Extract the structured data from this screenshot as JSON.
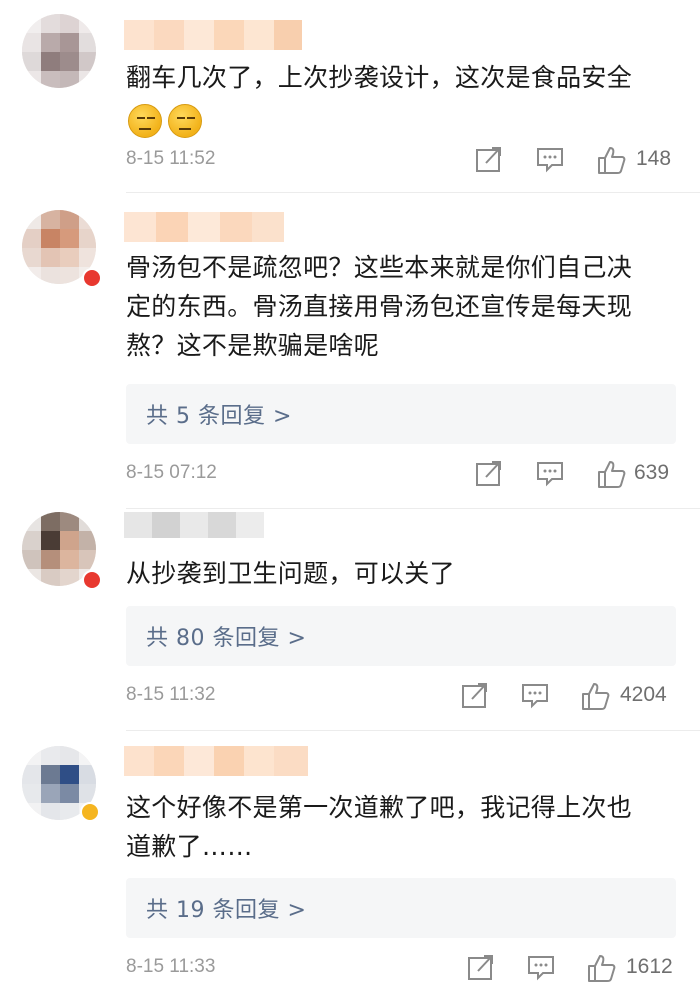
{
  "comments": [
    {
      "text_lines": [
        "翻车几次了，上次抄袭设计，这次是食品安全"
      ],
      "emoji_count": 2,
      "emoji_name": "sweat-smile-emoji",
      "time": "8-15 11:52",
      "likes": "148",
      "reply_label": null,
      "badge": "none"
    },
    {
      "text_lines": [
        "骨汤包不是疏忽吧？这些本来就是你们自己决",
        "定的东西。骨汤直接用骨汤包还宣传是每天现",
        "熬？这不是欺骗是啥呢"
      ],
      "time": "8-15 07:12",
      "likes": "639",
      "reply_label": "共 5 条回复 >",
      "badge": "red"
    },
    {
      "text_lines": [
        "从抄袭到卫生问题，可以关了"
      ],
      "time": "8-15 11:32",
      "likes": "4204",
      "reply_label": "共 80 条回复 >",
      "badge": "red"
    },
    {
      "text_lines": [
        "这个好像不是第一次道歉了吧，我记得上次也",
        "道歉了……"
      ],
      "time": "8-15 11:33",
      "likes": "1612",
      "reply_label": "共 19 条回复 >",
      "badge": "gold"
    }
  ],
  "icons": {
    "share": "share-icon",
    "comment": "comment-icon",
    "like": "thumbs-up-icon"
  },
  "colors": {
    "reply_text": "#5a6d8a",
    "reply_bg": "#f5f6f7",
    "meta_text": "#9a9a9a",
    "badge_red": "#e8382f",
    "badge_gold": "#f5b520",
    "username_blur": "#fbdcc4"
  }
}
